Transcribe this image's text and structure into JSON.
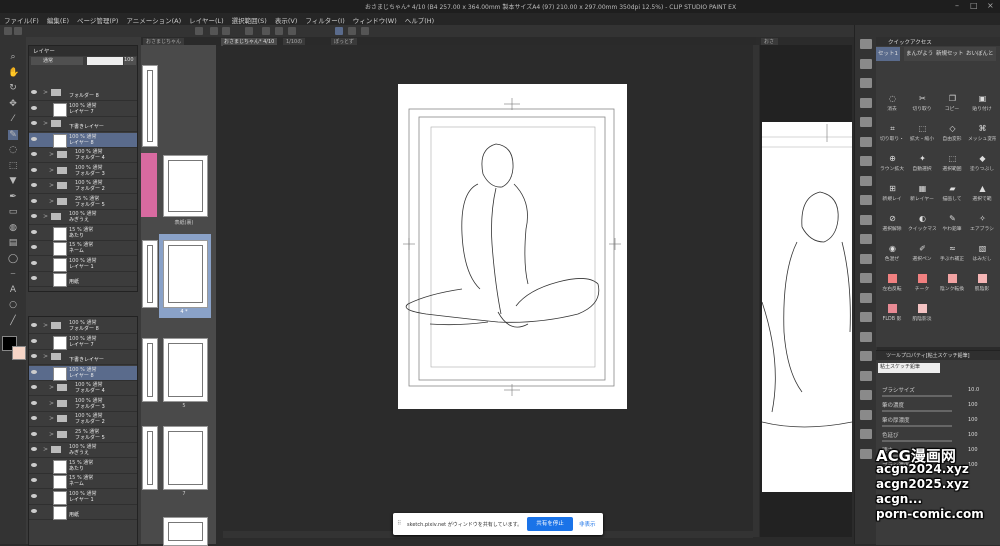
{
  "app": {
    "title": "おさまじちゃん* 4/10 (B4 257.00 x 364.00mm 製本サイズA4 (97) 210.00 x 297.00mm 350dpi 12.5%) - CLIP STUDIO PAINT EX"
  },
  "menu": [
    "ファイル(F)",
    "編集(E)",
    "ページ管理(P)",
    "アニメーション(A)",
    "レイヤー(L)",
    "選択範囲(S)",
    "表示(V)",
    "フィルター(I)",
    "ウィンドウ(W)",
    "ヘルプ(H)"
  ],
  "tabs": [
    "おさまじちゃん",
    "おさまじちゃん* 4/10",
    "1/10の",
    "ぽっとず"
  ],
  "view2_tab": "おさまじちゃん* 4/10",
  "layer_panel": {
    "header": "レイヤー",
    "blend": "通常",
    "opacity": "100"
  },
  "layers_top": [
    {
      "l1": "",
      "l2": "フォルダー 8",
      "type": "folder",
      "indent": 1
    },
    {
      "l1": "100 % 通常",
      "l2": "レイヤー 7",
      "type": "layer",
      "indent": 1
    },
    {
      "l1": "",
      "l2": "下書きレイヤー",
      "type": "folder",
      "indent": 1
    },
    {
      "l1": "100 % 通常",
      "l2": "レイヤー 8",
      "type": "layer",
      "indent": 1,
      "sel": true
    },
    {
      "l1": "100 % 通常",
      "l2": "フォルダー 4",
      "type": "folder",
      "indent": 2
    },
    {
      "l1": "100 % 通常",
      "l2": "フォルダー 3",
      "type": "folder",
      "indent": 2
    },
    {
      "l1": "100 % 通常",
      "l2": "フォルダー 2",
      "type": "folder",
      "indent": 2
    },
    {
      "l1": "25 % 通常",
      "l2": "フォルダー 5",
      "type": "folder",
      "indent": 2
    },
    {
      "l1": "100 % 通常",
      "l2": "みぎうえ",
      "type": "folder",
      "indent": 1
    },
    {
      "l1": "15 % 通常",
      "l2": "あたり",
      "type": "layer",
      "indent": 1
    },
    {
      "l1": "15 % 通常",
      "l2": "ネーム",
      "type": "layer",
      "indent": 1
    },
    {
      "l1": "100 % 通常",
      "l2": "レイヤー 1",
      "type": "layer",
      "indent": 1
    },
    {
      "l1": "",
      "l2": "用紙",
      "type": "paper",
      "indent": 1
    }
  ],
  "layers_bottom": [
    {
      "l1": "100 % 通常",
      "l2": "フォルダー 8",
      "type": "folder",
      "indent": 1
    },
    {
      "l1": "100 % 通常",
      "l2": "レイヤー 7",
      "type": "layer",
      "indent": 1
    },
    {
      "l1": "",
      "l2": "下書きレイヤー",
      "type": "folder",
      "indent": 1
    },
    {
      "l1": "100 % 通常",
      "l2": "レイヤー 8",
      "type": "layer",
      "indent": 1,
      "sel": true
    },
    {
      "l1": "100 % 通常",
      "l2": "フォルダー 4",
      "type": "folder",
      "indent": 2
    },
    {
      "l1": "100 % 通常",
      "l2": "フォルダー 3",
      "type": "folder",
      "indent": 2
    },
    {
      "l1": "100 % 通常",
      "l2": "フォルダー 2",
      "type": "folder",
      "indent": 2
    },
    {
      "l1": "25 % 通常",
      "l2": "フォルダー 5",
      "type": "folder",
      "indent": 2
    },
    {
      "l1": "100 % 通常",
      "l2": "みぎうえ",
      "type": "folder",
      "indent": 1
    },
    {
      "l1": "15 % 通常",
      "l2": "あたり",
      "type": "layer",
      "indent": 1
    },
    {
      "l1": "15 % 通常",
      "l2": "ネーム",
      "type": "layer",
      "indent": 1
    },
    {
      "l1": "100 % 通常",
      "l2": "レイヤー 1",
      "type": "layer",
      "indent": 1
    },
    {
      "l1": "",
      "l2": "用紙",
      "type": "paper",
      "indent": 1
    }
  ],
  "pages": [
    {
      "label": ""
    },
    {
      "label": "表紙(裏)"
    },
    {
      "label": "4 *"
    },
    {
      "label": "5"
    },
    {
      "label": "7"
    }
  ],
  "quick_access": {
    "title": "クイックアクセス",
    "tabs": [
      "セット1",
      "まんがよう",
      "新規セット",
      "おいぼんと"
    ],
    "items": [
      {
        "label": "消去",
        "icon": "dotted-circle"
      },
      {
        "label": "切り取り",
        "icon": "scissors"
      },
      {
        "label": "コピー",
        "icon": "copy"
      },
      {
        "label": "貼り付け",
        "icon": "paste"
      },
      {
        "label": "切り取り・",
        "icon": "crop"
      },
      {
        "label": "拡大・縮小",
        "icon": "transform"
      },
      {
        "label": "自由変形",
        "icon": "free-transform"
      },
      {
        "label": "メッシュ変形",
        "icon": "mesh"
      },
      {
        "label": "ラウン拡大",
        "icon": "zoom"
      },
      {
        "label": "自動選択",
        "icon": "wand"
      },
      {
        "label": "選択範囲",
        "icon": "select"
      },
      {
        "label": "塗りつぶし",
        "icon": "bucket"
      },
      {
        "label": "新規レイ",
        "icon": "new-layer"
      },
      {
        "label": "新レイヤー",
        "icon": "layer-add"
      },
      {
        "label": "描画して",
        "icon": "draw"
      },
      {
        "label": "選択で範",
        "icon": "fire"
      },
      {
        "label": "選択解除",
        "icon": "deselect"
      },
      {
        "label": "クイックマスク",
        "icon": "quickmask"
      },
      {
        "label": "やわ鉛筆",
        "icon": "pencil"
      },
      {
        "label": "エアブラシ",
        "icon": "airbrush"
      },
      {
        "label": "色混ぜ",
        "icon": "blend"
      },
      {
        "label": "選択ペン",
        "icon": "select-pen"
      },
      {
        "label": "手ぶれ補正",
        "icon": "stabilizer"
      },
      {
        "label": "はみだし",
        "icon": "overflow"
      },
      {
        "label": "左右反転",
        "icon": "flip"
      },
      {
        "label": "チーク",
        "icon": "cheek"
      },
      {
        "label": "陰ンク転換",
        "icon": "shadow"
      },
      {
        "label": "肌陰影",
        "icon": "skin-shadow"
      },
      {
        "label": "FLDB 影",
        "icon": "fldb"
      },
      {
        "label": "肌陰影淡",
        "icon": "skin-light"
      }
    ],
    "swatches": [
      "#f08080",
      "#f2a3a3",
      "#f5b5b5",
      "#e88a94",
      "#f3c2c2",
      "#f0a4a8"
    ]
  },
  "tool_property": {
    "title": "ツールプロパティ[粘土スケッチ鉛筆]",
    "brush_name": "粘土スケッチ鉛筆",
    "rows": [
      {
        "label": "ブラシサイズ",
        "value": "10.0"
      },
      {
        "label": "筆の濃度",
        "value": "100"
      },
      {
        "label": "筆の厚濃度",
        "value": "100"
      },
      {
        "label": "色延び",
        "value": "100"
      },
      {
        "label": "硬さ",
        "value": "100"
      },
      {
        "label": "ブラシ濃度",
        "value": "100"
      }
    ]
  },
  "share_bar": {
    "message": "sketch.pixiv.net がウィンドウを共有しています。",
    "stop": "共有を停止",
    "hide": "非表示"
  },
  "watermark": [
    "ACG漫画网",
    "acgn2024.xyz",
    "acgn2025.xyz",
    "acgn...",
    "porn-comic.com"
  ],
  "status": {
    "zoom": "12.5"
  },
  "colors": {
    "main": "#000000",
    "sub": "#f7d6c8",
    "accent": "#5a6b8c",
    "share_button": "#1a73e8"
  }
}
